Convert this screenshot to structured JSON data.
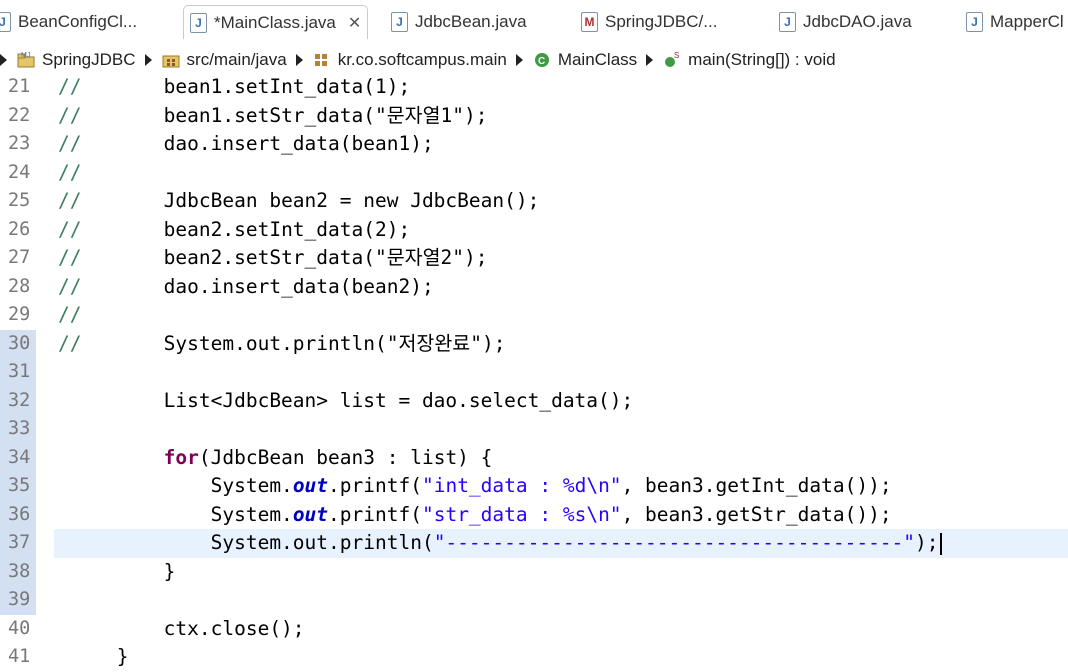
{
  "tabs": [
    {
      "label": "BeanConfigCl...",
      "icon": "J",
      "active": false
    },
    {
      "label": "*MainClass.java",
      "icon": "J",
      "active": true,
      "close": "✕"
    },
    {
      "label": "JdbcBean.java",
      "icon": "J",
      "active": false
    },
    {
      "label": "SpringJDBC/...",
      "icon": "M",
      "active": false
    },
    {
      "label": "JdbcDAO.java",
      "icon": "J",
      "active": false
    },
    {
      "label": "MapperCl",
      "icon": "J",
      "active": false
    }
  ],
  "breadcrumb": [
    {
      "label": "SpringJDBC",
      "icon": "project-icon"
    },
    {
      "label": "src/main/java",
      "icon": "source-folder-icon"
    },
    {
      "label": "kr.co.softcampus.main",
      "icon": "package-icon"
    },
    {
      "label": "MainClass",
      "icon": "class-icon"
    },
    {
      "label": "main(String[]) : void",
      "icon": "method-icon"
    }
  ],
  "editor": {
    "current_line": 37,
    "lines": [
      {
        "n": "21",
        "tokens": [
          {
            "t": "cm",
            "v": "//"
          },
          {
            "t": "",
            "v": "       bean1.setInt_data(1);"
          }
        ]
      },
      {
        "n": "22",
        "tokens": [
          {
            "t": "cm",
            "v": "//"
          },
          {
            "t": "",
            "v": "       bean1.setStr_data(\"문자열1\");"
          }
        ]
      },
      {
        "n": "23",
        "tokens": [
          {
            "t": "cm",
            "v": "//"
          },
          {
            "t": "",
            "v": "       dao.insert_data(bean1);"
          }
        ]
      },
      {
        "n": "24",
        "tokens": [
          {
            "t": "cm",
            "v": "//"
          }
        ]
      },
      {
        "n": "25",
        "tokens": [
          {
            "t": "cm",
            "v": "//"
          },
          {
            "t": "",
            "v": "       JdbcBean bean2 = new JdbcBean();"
          }
        ]
      },
      {
        "n": "26",
        "tokens": [
          {
            "t": "cm",
            "v": "//"
          },
          {
            "t": "",
            "v": "       bean2.setInt_data(2);"
          }
        ]
      },
      {
        "n": "27",
        "tokens": [
          {
            "t": "cm",
            "v": "//"
          },
          {
            "t": "",
            "v": "       bean2.setStr_data(\"문자열2\");"
          }
        ]
      },
      {
        "n": "28",
        "tokens": [
          {
            "t": "cm",
            "v": "//"
          },
          {
            "t": "",
            "v": "       dao.insert_data(bean2);"
          }
        ]
      },
      {
        "n": "29",
        "tokens": [
          {
            "t": "cm",
            "v": "//"
          }
        ]
      },
      {
        "n": "30",
        "tokens": [
          {
            "t": "cm",
            "v": "//"
          },
          {
            "t": "",
            "v": "       System.out.println(\"저장완료\");"
          }
        ]
      },
      {
        "n": "31",
        "tokens": []
      },
      {
        "n": "32",
        "tokens": [
          {
            "t": "",
            "v": "         List<JdbcBean> list = dao.select_data();"
          }
        ]
      },
      {
        "n": "33",
        "tokens": []
      },
      {
        "n": "34",
        "tokens": [
          {
            "t": "",
            "v": "         "
          },
          {
            "t": "kw",
            "v": "for"
          },
          {
            "t": "",
            "v": "(JdbcBean bean3 : list) {"
          }
        ]
      },
      {
        "n": "35",
        "tokens": [
          {
            "t": "",
            "v": "             System."
          },
          {
            "t": "fld",
            "v": "out"
          },
          {
            "t": "",
            "v": ".printf("
          },
          {
            "t": "st",
            "v": "\"int_data : %d\\n\""
          },
          {
            "t": "",
            "v": ", bean3.getInt_data());"
          }
        ]
      },
      {
        "n": "36",
        "tokens": [
          {
            "t": "",
            "v": "             System."
          },
          {
            "t": "fld",
            "v": "out"
          },
          {
            "t": "",
            "v": ".printf("
          },
          {
            "t": "st",
            "v": "\"str_data : %s\\n\""
          },
          {
            "t": "",
            "v": ", bean3.getStr_data());"
          }
        ]
      },
      {
        "n": "37",
        "tokens": [
          {
            "t": "",
            "v": "             System.out.println("
          },
          {
            "t": "st",
            "v": "\"---------------------------------------\""
          },
          {
            "t": "",
            "v": ");"
          }
        ]
      },
      {
        "n": "38",
        "tokens": [
          {
            "t": "",
            "v": "         }"
          }
        ]
      },
      {
        "n": "39",
        "tokens": []
      },
      {
        "n": "40",
        "tokens": [
          {
            "t": "",
            "v": "         ctx.close();"
          }
        ]
      },
      {
        "n": "41",
        "tokens": [
          {
            "t": "",
            "v": "     }"
          }
        ]
      }
    ]
  },
  "colors": {
    "comment": "#3f7f5f",
    "keyword": "#7f0055",
    "string": "#2a00ff",
    "field": "#0000c0",
    "current_line_bg": "#e8f2fe",
    "changed_gutter": "#d3e0f2"
  }
}
